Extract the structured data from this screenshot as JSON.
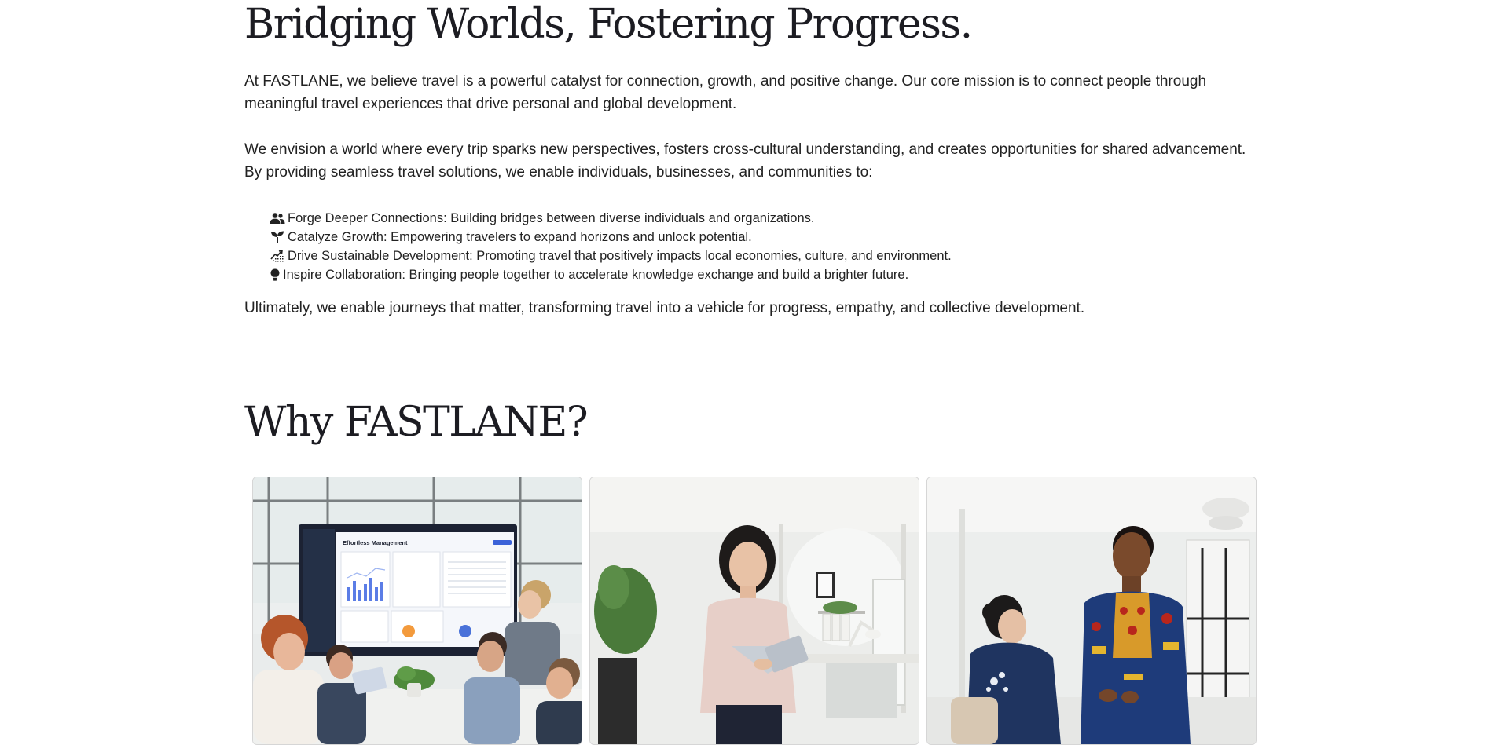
{
  "mission": {
    "title": "Bridging Worlds, Fostering Progress.",
    "paragraph1": "At FASTLANE, we believe travel is a powerful catalyst for connection, growth, and positive change. Our core mission is to connect people through meaningful travel experiences that drive personal and global development.",
    "paragraph2": "We envision a world where every trip sparks new perspectives, fosters cross-cultural understanding, and creates opportunities for shared advancement. By providing seamless travel solutions, we enable individuals, businesses, and communities to:",
    "bullets": [
      {
        "icon": "people-icon",
        "text": "Forge Deeper Connections: Building bridges between diverse individuals and organizations."
      },
      {
        "icon": "sprout-icon",
        "text": "Catalyze Growth: Empowering travelers to expand horizons and unlock potential."
      },
      {
        "icon": "growth-chart-icon",
        "text": "Drive Sustainable Development: Promoting travel that positively impacts local economies, culture, and environment."
      },
      {
        "icon": "lightbulb-icon",
        "text": "Inspire Collaboration: Bringing people together to accelerate knowledge exchange and build a brighter future."
      }
    ],
    "closing": "Ultimately, we enable journeys that matter, transforming travel into a vehicle for progress, empathy, and collective development."
  },
  "why": {
    "title": "Why FASTLANE?",
    "cards": [
      {
        "image": "team-meeting-dashboard-photo",
        "screen_title": "Effortless Management"
      },
      {
        "image": "woman-with-tablet-office-photo"
      },
      {
        "image": "two-people-conversation-photo"
      }
    ]
  }
}
